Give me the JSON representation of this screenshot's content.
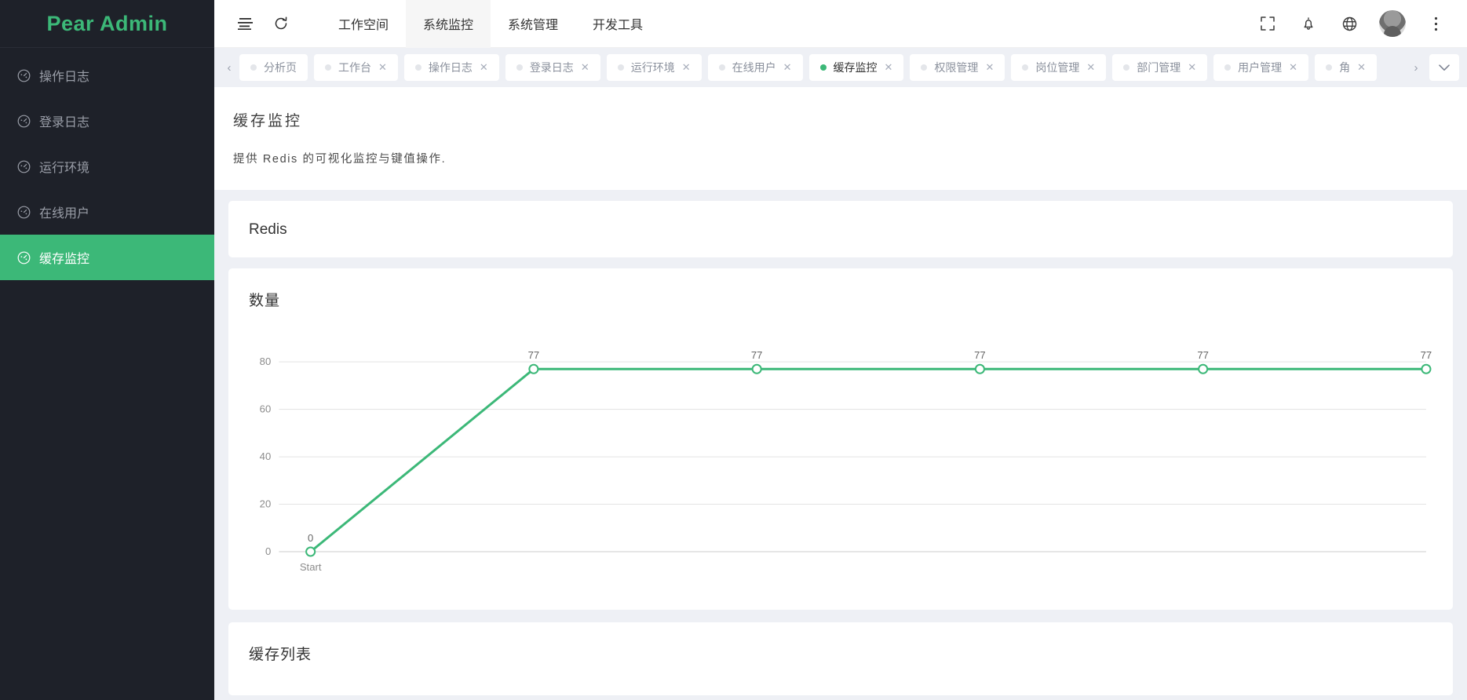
{
  "brand": {
    "name": "Pear Admin",
    "color": "#3cb878"
  },
  "sidebar": {
    "items": [
      {
        "label": "操作日志",
        "icon": "gauge-icon",
        "active": false
      },
      {
        "label": "登录日志",
        "icon": "gauge-icon",
        "active": false
      },
      {
        "label": "运行环境",
        "icon": "gauge-icon",
        "active": false
      },
      {
        "label": "在线用户",
        "icon": "gauge-icon",
        "active": false
      },
      {
        "label": "缓存监控",
        "icon": "gauge-icon",
        "active": true
      }
    ]
  },
  "header": {
    "menu_icon": "hamburger-icon",
    "refresh_icon": "refresh-icon",
    "nav": [
      {
        "label": "工作空间",
        "active": false
      },
      {
        "label": "系统监控",
        "active": true
      },
      {
        "label": "系统管理",
        "active": false
      },
      {
        "label": "开发工具",
        "active": false
      }
    ],
    "actions": [
      {
        "name": "fullscreen-icon"
      },
      {
        "name": "bell-icon"
      },
      {
        "name": "globe-icon"
      },
      {
        "name": "avatar"
      },
      {
        "name": "more-vertical-icon"
      }
    ]
  },
  "tabbar": {
    "prev_label": "‹",
    "next_label": "›",
    "dropdown_label": "⌄",
    "close_label": "✕",
    "tabs": [
      {
        "label": "分析页",
        "active": false,
        "closable": false
      },
      {
        "label": "工作台",
        "active": false,
        "closable": true
      },
      {
        "label": "操作日志",
        "active": false,
        "closable": true
      },
      {
        "label": "登录日志",
        "active": false,
        "closable": true
      },
      {
        "label": "运行环境",
        "active": false,
        "closable": true
      },
      {
        "label": "在线用户",
        "active": false,
        "closable": true
      },
      {
        "label": "缓存监控",
        "active": true,
        "closable": true
      },
      {
        "label": "权限管理",
        "active": false,
        "closable": true
      },
      {
        "label": "岗位管理",
        "active": false,
        "closable": true
      },
      {
        "label": "部门管理",
        "active": false,
        "closable": true
      },
      {
        "label": "用户管理",
        "active": false,
        "closable": true
      },
      {
        "label": "角",
        "active": false,
        "closable": true
      }
    ]
  },
  "page": {
    "title": "缓存监控",
    "subtitle": "提供 Redis 的可视化监控与键值操作."
  },
  "cards": {
    "redis_title": "Redis",
    "count_title": "数量",
    "list_title": "缓存列表"
  },
  "chart_data": {
    "type": "line",
    "title": "数量",
    "categories": [
      "Start",
      "",
      "",
      "",
      "",
      ""
    ],
    "x": [
      0,
      1,
      2,
      3,
      4,
      5
    ],
    "values": [
      0,
      77,
      77,
      77,
      77,
      77
    ],
    "point_labels": [
      "0",
      "77",
      "77",
      "77",
      "77",
      "77"
    ],
    "xlabel": "",
    "ylabel": "",
    "ylim": [
      0,
      88
    ],
    "yticks": [
      0,
      20,
      40,
      60,
      80
    ],
    "ytick_labels": [
      "0",
      "20",
      "40",
      "60",
      "80"
    ],
    "xtick_labels": [
      "Start",
      "",
      "",
      "",
      "",
      ""
    ],
    "grid": true,
    "legend": false,
    "line_color": "#3cb878",
    "marker": "hollow-circle",
    "marker_fill": "#ffffff",
    "smooth": false
  }
}
